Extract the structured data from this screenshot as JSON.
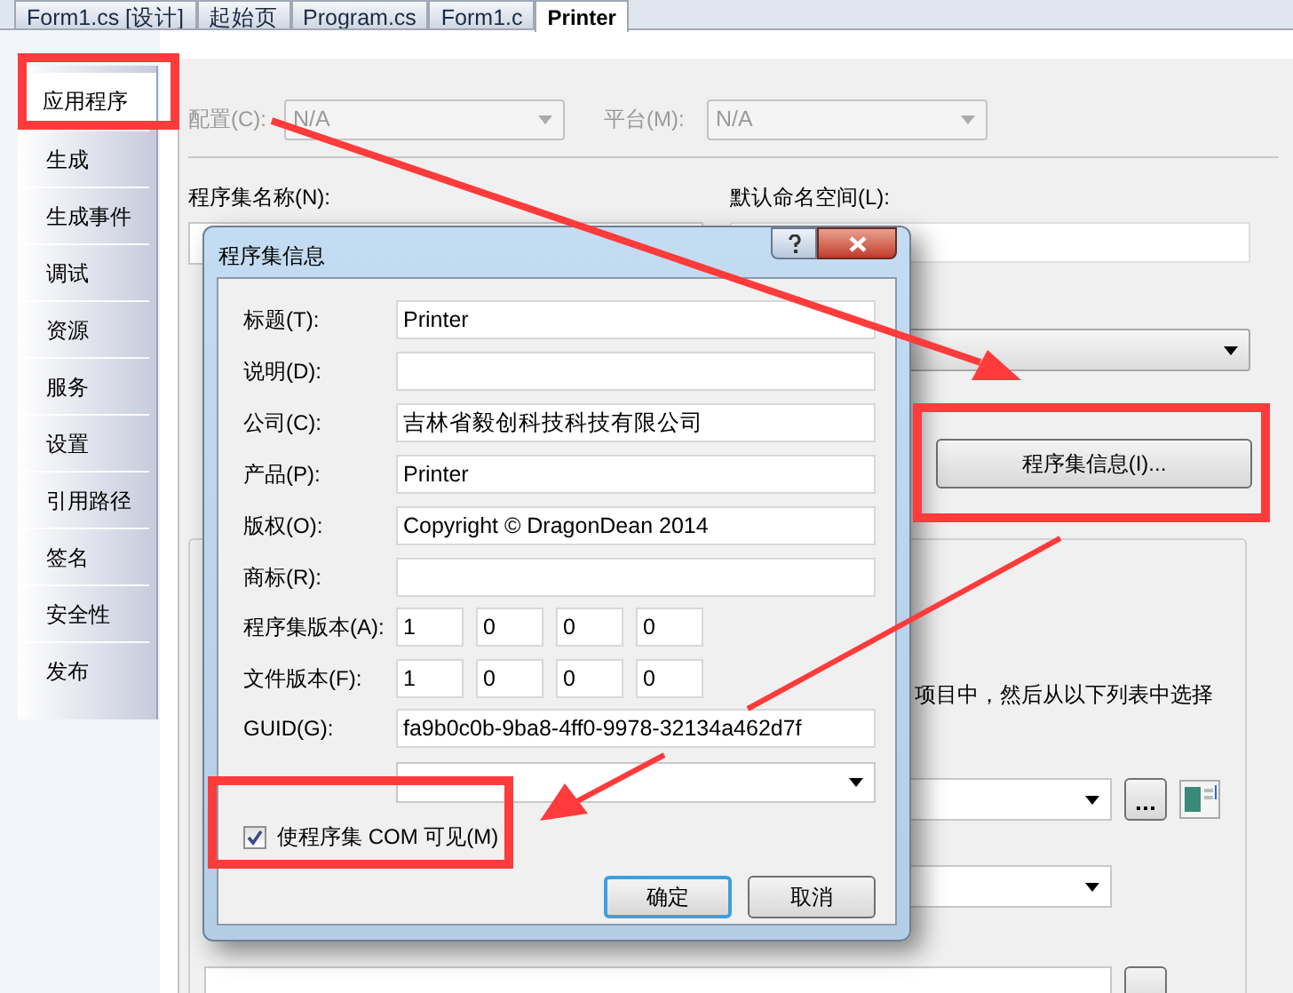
{
  "tabs": [
    {
      "label": "Form1.cs [设计]",
      "selected": false
    },
    {
      "label": "起始页",
      "selected": false
    },
    {
      "label": "Program.cs",
      "selected": false
    },
    {
      "label": "Form1.c",
      "selected": false
    },
    {
      "label": "Printer",
      "selected": true
    }
  ],
  "sidebar": {
    "items": [
      {
        "label": "应用程序",
        "selected": true
      },
      {
        "label": "生成",
        "selected": false
      },
      {
        "label": "生成事件",
        "selected": false
      },
      {
        "label": "调试",
        "selected": false
      },
      {
        "label": "资源",
        "selected": false
      },
      {
        "label": "服务",
        "selected": false
      },
      {
        "label": "设置",
        "selected": false
      },
      {
        "label": "引用路径",
        "selected": false
      },
      {
        "label": "签名",
        "selected": false
      },
      {
        "label": "安全性",
        "selected": false
      },
      {
        "label": "发布",
        "selected": false
      }
    ]
  },
  "config_bar": [
    {
      "label": "配置(C):",
      "value": "N/A",
      "disabled": true
    },
    {
      "label": "平台(M):",
      "value": "N/A",
      "disabled": true
    }
  ],
  "assembly_name": {
    "label": "程序集名称(N):"
  },
  "default_namespace": {
    "label": "默认命名空间(L):"
  },
  "assembly_info_button": "程序集信息(I)...",
  "resources_hint": "项目中，然后从以下列表中选择",
  "dialog": {
    "title": "程序集信息",
    "fields": [
      {
        "label": "标题(T):",
        "value": "Printer"
      },
      {
        "label": "说明(D):"
      },
      {
        "label": "公司(C):",
        "value": "吉林省毅创科技科技有限公司"
      },
      {
        "label": "产品(P):",
        "value": "Printer"
      },
      {
        "label": "版权(O):",
        "value": "Copyright © DragonDean 2014"
      },
      {
        "label": "商标(R):"
      }
    ],
    "versions": [
      {
        "label": "程序集版本(A):",
        "parts": [
          "1",
          "0",
          "0",
          "0"
        ]
      },
      {
        "label": "文件版本(F):",
        "parts": [
          "1",
          "0",
          "0",
          "0"
        ]
      }
    ],
    "guid": {
      "label": "GUID(G):",
      "value": "fa9b0c0b-9ba8-4ff0-9978-32134a462d7f"
    },
    "com_visible": {
      "label": "使程序集 COM 可见(M)",
      "checked": true
    },
    "buttons": [
      {
        "label": "确定",
        "default": true
      },
      {
        "label": "取消",
        "default": false
      }
    ]
  }
}
